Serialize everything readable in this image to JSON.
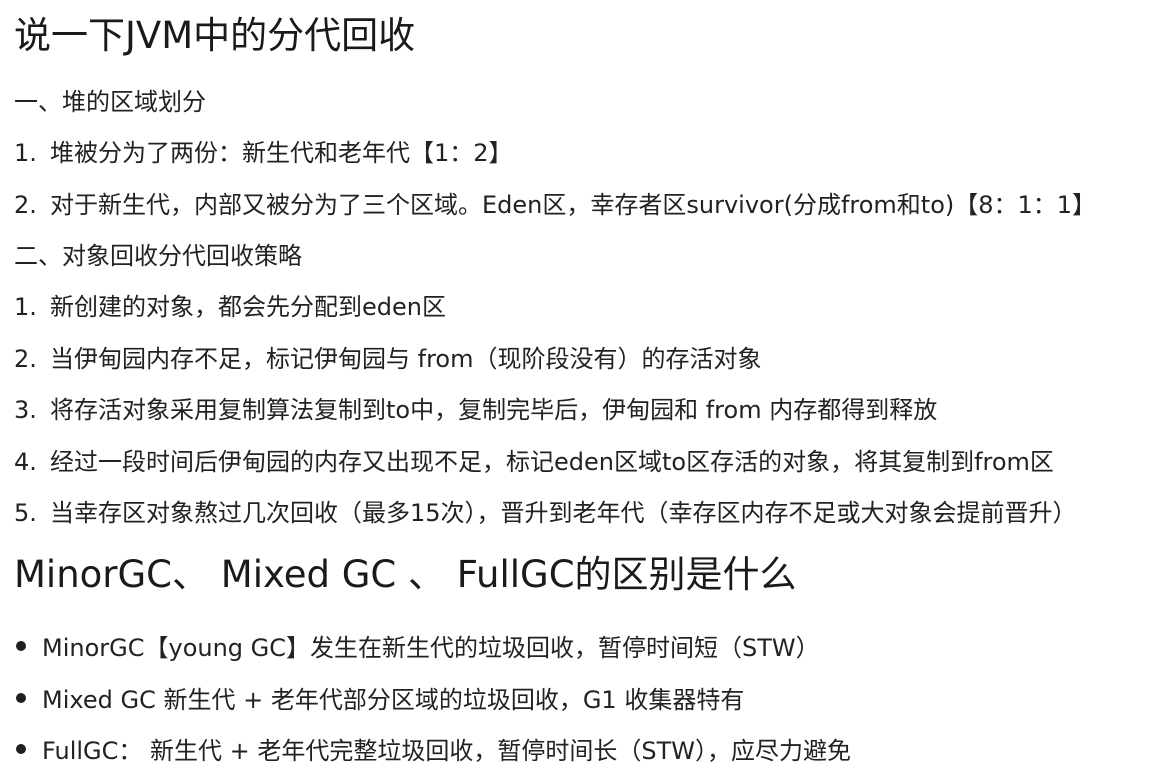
{
  "section1": {
    "title": "说一下JVM中的分代回收",
    "part1_heading": "一、堆的区域划分",
    "part1_items": [
      {
        "num": "1.",
        "text": "堆被分为了两份：新生代和老年代【1：2】"
      },
      {
        "num": "2.",
        "text": "对于新生代，内部又被分为了三个区域。Eden区，幸存者区survivor(分成from和to)【8：1：1】"
      }
    ],
    "part2_heading": "二、对象回收分代回收策略",
    "part2_items": [
      {
        "num": "1.",
        "text": "新创建的对象，都会先分配到eden区"
      },
      {
        "num": "2.",
        "text": "当伊甸园内存不足，标记伊甸园与 from（现阶段没有）的存活对象"
      },
      {
        "num": "3.",
        "text": "将存活对象采用复制算法复制到to中，复制完毕后，伊甸园和 from 内存都得到释放"
      },
      {
        "num": "4.",
        "text": "经过一段时间后伊甸园的内存又出现不足，标记eden区域to区存活的对象，将其复制到from区"
      },
      {
        "num": "5.",
        "text": "当幸存区对象熬过几次回收（最多15次），晋升到老年代（幸存区内存不足或大对象会提前晋升）"
      }
    ]
  },
  "section2": {
    "title": "MinorGC、 Mixed GC 、 FullGC的区别是什么",
    "bullets": [
      {
        "text": "MinorGC【young GC】发生在新生代的垃圾回收，暂停时间短（STW）"
      },
      {
        "text": "Mixed GC 新生代 + 老年代部分区域的垃圾回收，G1 收集器特有"
      },
      {
        "text": "FullGC： 新生代 + 老年代完整垃圾回收，暂停时间长（STW），应尽力避免"
      }
    ]
  }
}
